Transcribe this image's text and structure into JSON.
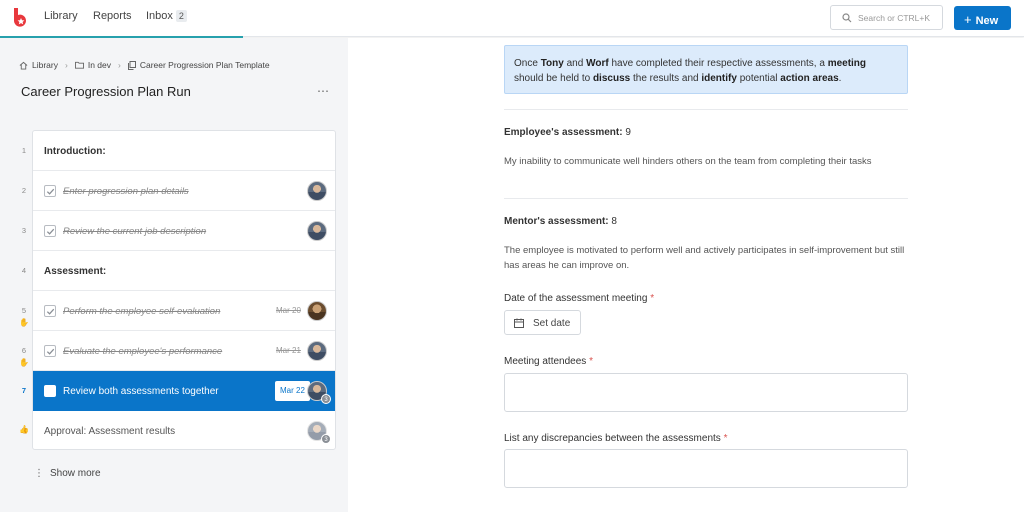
{
  "header": {
    "nav": {
      "library": "Library",
      "reports": "Reports",
      "inbox": "Inbox",
      "inbox_count": "2"
    },
    "search_placeholder": "Search or CTRL+K",
    "new_button": "New"
  },
  "sidebar": {
    "breadcrumb": [
      "Library",
      "In dev",
      "Career Progression Plan Template"
    ],
    "title": "Career Progression Plan Run",
    "more": "⋯",
    "rows": [
      {
        "num": "1",
        "text": "Introduction:"
      },
      {
        "num": "2",
        "text": "Enter progression plan details"
      },
      {
        "num": "3",
        "text": "Review the current job description"
      },
      {
        "num": "4",
        "text": "Assessment:"
      },
      {
        "num": "5",
        "text": "Perform the employee self-evaluation",
        "date": "Mar 20"
      },
      {
        "num": "6",
        "text": "Evaluate the employee's performance",
        "date": "Mar 21"
      },
      {
        "num": "7",
        "text": "Review both assessments together",
        "date": "Mar 22",
        "badge": "3"
      },
      {
        "num": "",
        "text": "Approval: Assessment results",
        "badge": "3"
      }
    ],
    "show_more": "Show more"
  },
  "main": {
    "info": {
      "p1": "Once ",
      "name1": "Tony",
      "p2": " and ",
      "name2": "Worf",
      "p3": " have completed their respective assessments, a ",
      "k1": "meeting",
      "p4": " should be held to ",
      "k2": "discuss",
      "p5": " the results and ",
      "k3": "identify",
      "p6": " potential ",
      "k4": "action areas",
      "p7": "."
    },
    "employee_label": "Employee's assessment:",
    "employee_score": " 9",
    "employee_text": "My inability to communicate well hinders others on the team from completing their tasks",
    "mentor_label": "Mentor's assessment:",
    "mentor_score": " 8",
    "mentor_text": "The employee is motivated to perform well and actively participates in self-improvement but still has areas he can improve on.",
    "date_label": "Date of the assessment meeting",
    "set_date": "Set date",
    "attendees_label": "Meeting attendees",
    "discrepancies_label": "List any discrepancies between the assessments",
    "required": "*"
  }
}
